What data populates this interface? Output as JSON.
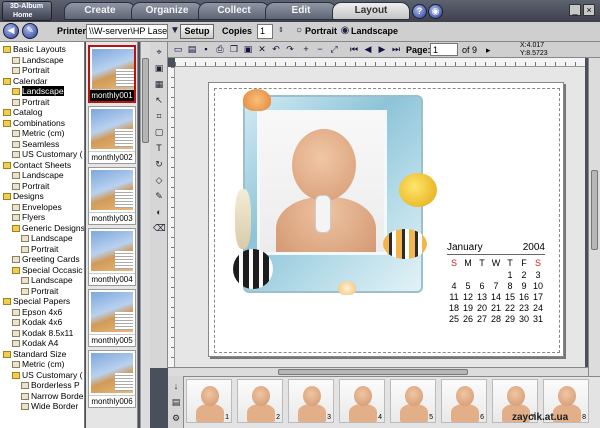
{
  "app": {
    "logo_line1": "3D-Album",
    "logo_line2": "Home"
  },
  "tabs": [
    {
      "label": "Create"
    },
    {
      "label": "Organize"
    },
    {
      "label": "Collect"
    },
    {
      "label": "Edit"
    },
    {
      "label": "Layout"
    }
  ],
  "toolbar": {
    "printer_label": "Printer",
    "printer_value": "\\\\W-server\\HP LaserJet",
    "setup_label": "Setup",
    "copies_label": "Copies",
    "copies_value": "1",
    "portrait_label": "Portrait",
    "landscape_label": "Landscape",
    "page_label": "Page:",
    "page_value": "1",
    "page_total": "of 9",
    "x_coord": "X:4.017",
    "y_coord": "Y:8.5723"
  },
  "tree": [
    {
      "label": "Basic Layouts",
      "indent": 0,
      "type": "folder"
    },
    {
      "label": "Landscape",
      "indent": 1,
      "type": "doc"
    },
    {
      "label": "Portrait",
      "indent": 1,
      "type": "doc"
    },
    {
      "label": "Calendar",
      "indent": 0,
      "type": "folder"
    },
    {
      "label": "Landscape",
      "indent": 1,
      "type": "folder",
      "selected": true
    },
    {
      "label": "Portrait",
      "indent": 1,
      "type": "doc"
    },
    {
      "label": "Catalog",
      "indent": 0,
      "type": "folder"
    },
    {
      "label": "Combinations",
      "indent": 0,
      "type": "folder"
    },
    {
      "label": "Metric (cm)",
      "indent": 1,
      "type": "doc"
    },
    {
      "label": "Seamless",
      "indent": 1,
      "type": "doc"
    },
    {
      "label": "US Customary (",
      "indent": 1,
      "type": "doc"
    },
    {
      "label": "Contact Sheets",
      "indent": 0,
      "type": "folder"
    },
    {
      "label": "Landscape",
      "indent": 1,
      "type": "doc"
    },
    {
      "label": "Portrait",
      "indent": 1,
      "type": "doc"
    },
    {
      "label": "Designs",
      "indent": 0,
      "type": "folder"
    },
    {
      "label": "Envelopes",
      "indent": 1,
      "type": "doc"
    },
    {
      "label": "Flyers",
      "indent": 1,
      "type": "doc"
    },
    {
      "label": "Generic Designs",
      "indent": 1,
      "type": "folder"
    },
    {
      "label": "Landscape",
      "indent": 2,
      "type": "doc"
    },
    {
      "label": "Portrait",
      "indent": 2,
      "type": "doc"
    },
    {
      "label": "Greeting Cards",
      "indent": 1,
      "type": "doc"
    },
    {
      "label": "Special Occasic",
      "indent": 1,
      "type": "folder"
    },
    {
      "label": "Landscape",
      "indent": 2,
      "type": "doc"
    },
    {
      "label": "Portrait",
      "indent": 2,
      "type": "doc"
    },
    {
      "label": "Special Papers",
      "indent": 0,
      "type": "folder"
    },
    {
      "label": "Epson 4x6",
      "indent": 1,
      "type": "doc"
    },
    {
      "label": "Kodak 4x6",
      "indent": 1,
      "type": "doc"
    },
    {
      "label": "Kodak 8.5x11",
      "indent": 1,
      "type": "doc"
    },
    {
      "label": "Kodak A4",
      "indent": 1,
      "type": "doc"
    },
    {
      "label": "Standard Size",
      "indent": 0,
      "type": "folder"
    },
    {
      "label": "Metric (cm)",
      "indent": 1,
      "type": "doc"
    },
    {
      "label": "US Customary (",
      "indent": 1,
      "type": "folder"
    },
    {
      "label": "Borderless P",
      "indent": 2,
      "type": "doc"
    },
    {
      "label": "Narrow Borde",
      "indent": 2,
      "type": "doc"
    },
    {
      "label": "Wide Border",
      "indent": 2,
      "type": "doc"
    }
  ],
  "thumbnails": [
    {
      "label": "monthly001",
      "selected": true
    },
    {
      "label": "monthly002"
    },
    {
      "label": "monthly003"
    },
    {
      "label": "monthly004"
    },
    {
      "label": "monthly005"
    },
    {
      "label": "monthly006"
    }
  ],
  "calendar": {
    "month": "January",
    "year": "2004",
    "weekdays": [
      "S",
      "M",
      "T",
      "W",
      "T",
      "F",
      "S"
    ],
    "weeks": [
      [
        "",
        "",
        "",
        "",
        "1",
        "2",
        "3"
      ],
      [
        "4",
        "5",
        "6",
        "7",
        "8",
        "9",
        "10"
      ],
      [
        "11",
        "12",
        "13",
        "14",
        "15",
        "16",
        "17"
      ],
      [
        "18",
        "19",
        "20",
        "21",
        "22",
        "23",
        "24"
      ],
      [
        "25",
        "26",
        "27",
        "28",
        "29",
        "30",
        "31"
      ]
    ],
    "weekend_color": "#cc2222"
  },
  "filmstrip": [
    "1",
    "2",
    "3",
    "4",
    "5",
    "6",
    "7",
    "8"
  ],
  "watermark": "zaycik.at.ua",
  "icons": {
    "rotate": "rotate-icon",
    "zoom": "zoom-icon",
    "text": "text-tool-icon",
    "pointer": "pointer-icon"
  }
}
